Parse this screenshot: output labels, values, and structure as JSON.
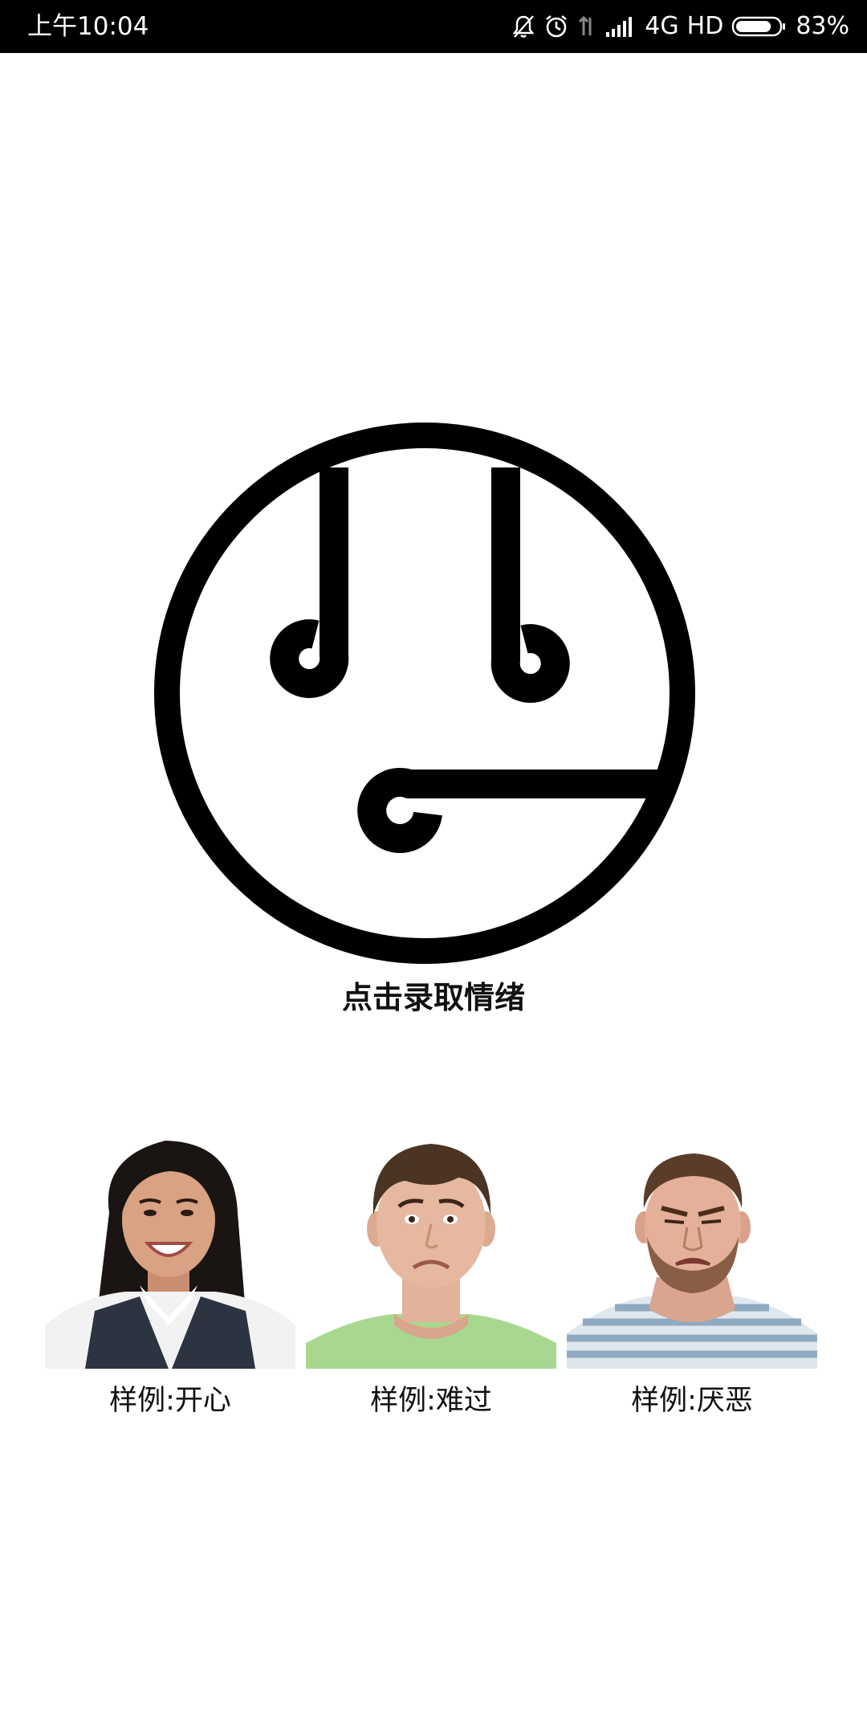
{
  "status_bar": {
    "time": "上午10:04",
    "network": "4G",
    "hd": "HD",
    "battery_percent": "83%",
    "battery_level": 0.83,
    "icons": [
      "mute-icon",
      "alarm-icon",
      "data-transfer-icon",
      "signal-icon",
      "battery-icon"
    ]
  },
  "record": {
    "logo_icon": "emotion-face-logo",
    "caption": "点击录取情绪"
  },
  "examples": [
    {
      "label": "样例:开心",
      "emotion": "happy",
      "icon": "happy-face-photo"
    },
    {
      "label": "样例:难过",
      "emotion": "sad",
      "icon": "sad-face-photo"
    },
    {
      "label": "样例:厌恶",
      "emotion": "disgust",
      "icon": "disgust-face-photo"
    }
  ],
  "colors": {
    "status_bar_bg": "#000000",
    "background": "#ffffff",
    "text": "#111111"
  }
}
